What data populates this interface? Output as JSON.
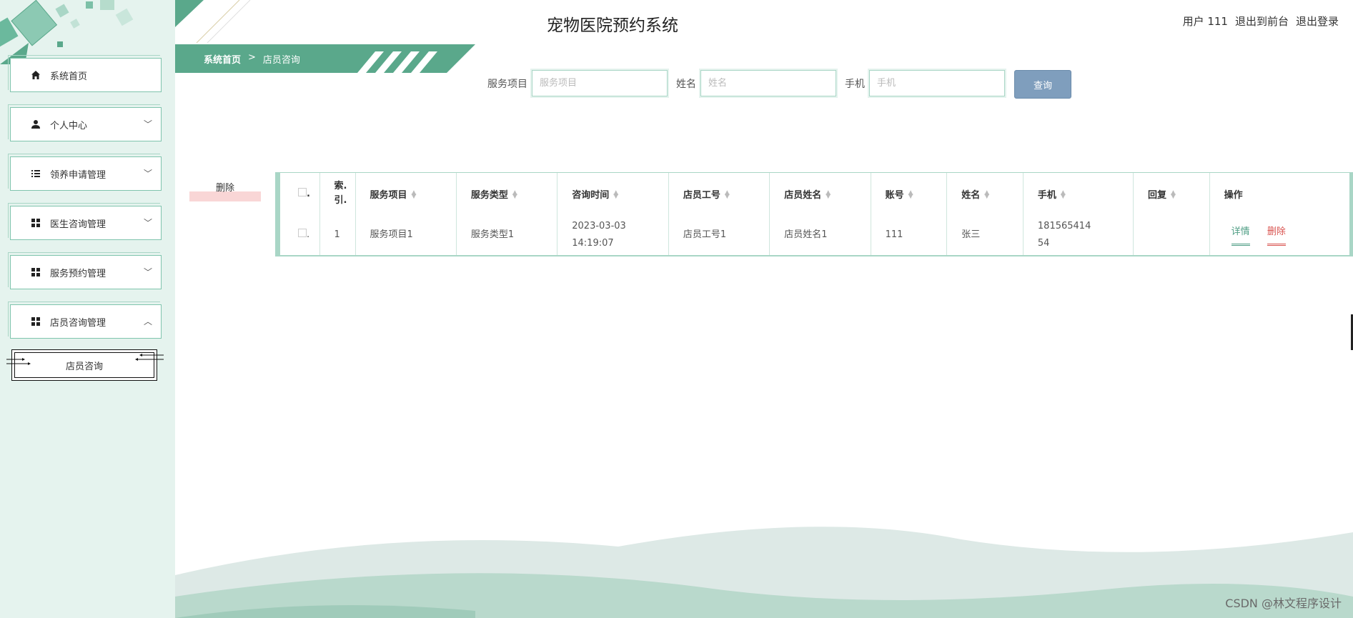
{
  "app": {
    "title": "宠物医院预约系统"
  },
  "header": {
    "user_label": "用户 111",
    "front_link": "退出到前台",
    "logout_link": "退出登录"
  },
  "sidebar": {
    "items": [
      {
        "label": "系统首页",
        "icon": "home-icon"
      },
      {
        "label": "个人中心",
        "icon": "person-icon"
      },
      {
        "label": "领养申请管理",
        "icon": "list-icon"
      },
      {
        "label": "医生咨询管理",
        "icon": "grid-icon"
      },
      {
        "label": "服务预约管理",
        "icon": "grid-icon"
      },
      {
        "label": "店员咨询管理",
        "icon": "grid-icon"
      }
    ],
    "submenu_label": "店员咨询"
  },
  "breadcrumb": {
    "home": "系统首页",
    "separator": ">",
    "current": "店员咨询"
  },
  "search": {
    "fields": [
      {
        "label": "服务项目",
        "placeholder": "服务项目"
      },
      {
        "label": "姓名",
        "placeholder": "姓名"
      },
      {
        "label": "手机",
        "placeholder": "手机"
      }
    ],
    "query_button": "查询"
  },
  "batch_delete_label": "删除",
  "table": {
    "headers": [
      "索引",
      "服务项目",
      "服务类型",
      "咨询时间",
      "店员工号",
      "店员姓名",
      "账号",
      "姓名",
      "手机",
      "回复",
      "操作"
    ],
    "index_header_lines": [
      "索.",
      "引."
    ],
    "rows": [
      {
        "index": "1",
        "service_item": "服务项目1",
        "service_type": "服务类型1",
        "time_date": "2023-03-03",
        "time_clock": "14:19:07",
        "staff_no": "店员工号1",
        "staff_name": "店员姓名1",
        "account": "111",
        "name": "张三",
        "phone_line1": "181565414",
        "phone_line2": "54",
        "reply": "",
        "actions": {
          "detail": "详情",
          "delete": "删除"
        }
      }
    ]
  },
  "watermark": "CSDN @林文程序设计",
  "colors": {
    "sidebar_bg": "#e5f3ee",
    "accent": "#5aa88b",
    "query_button": "#7f9ebd",
    "danger": "#d9534f"
  }
}
